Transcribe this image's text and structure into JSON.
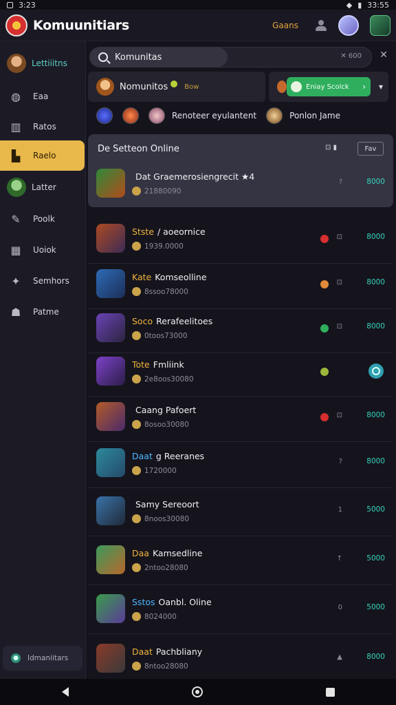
{
  "status": {
    "time": "3:23",
    "right": "33:55"
  },
  "appbar": {
    "title": "Komuunitiars",
    "games_link": "Gaans"
  },
  "sidebar": {
    "items": [
      {
        "label": "Lettiiitns",
        "icon": "avatar-icon"
      },
      {
        "label": "Eaa",
        "icon": "gamepad-icon"
      },
      {
        "label": "Ratos",
        "icon": "stats-icon"
      },
      {
        "label": "Raelo",
        "icon": "bookmark-icon",
        "active": true
      },
      {
        "label": "Latter",
        "icon": "avatar-icon"
      },
      {
        "label": "Poolk",
        "icon": "paint-icon"
      },
      {
        "label": "Uoiok",
        "icon": "calendar-icon"
      },
      {
        "label": "Semhors",
        "icon": "puzzle-icon"
      },
      {
        "label": "Patme",
        "icon": "people-icon"
      }
    ],
    "footer_label": "Idmaniitars"
  },
  "search": {
    "value": "Komunitas",
    "hint": "✕ 600"
  },
  "community": {
    "name": "Nomunitos",
    "extra": "Bow"
  },
  "join": {
    "button_label": "Eniay Scolck"
  },
  "chips": {
    "label1": "Renoteer eyulantent",
    "label2": "Ponlon Jame"
  },
  "section": {
    "title": "De Setteon Online",
    "icons": "⊡ ▮",
    "button_label": "Fav"
  },
  "rows": [
    {
      "tag": "",
      "tag_color": "#ffffff",
      "name": "Dat Graemerosiengrecit ★4",
      "sub": "21880090",
      "ind": "",
      "mini": "?",
      "val": "8000",
      "thumb_a": "#2f8a3a",
      "thumb_b": "#b24b1b"
    },
    {
      "tag": "Stste",
      "tag_color": "#f1b43d",
      "name": "/ aoeornice",
      "sub": "1939.0000",
      "ind": "#d62f2f",
      "mini": "⊡",
      "val": "8000",
      "thumb_a": "#ad4a22",
      "thumb_b": "#3c2b55"
    },
    {
      "tag": "Kate",
      "tag_color": "#f1b43d",
      "name": "Komseolline",
      "sub": "8ssoo78000",
      "ind": "#e08a3a",
      "mini": "⊡",
      "val": "8000",
      "thumb_a": "#2d6bb5",
      "thumb_b": "#1c2f58"
    },
    {
      "tag": "Soco",
      "tag_color": "#f1b43d",
      "name": "Rerafeelitoes",
      "sub": "0toos73000",
      "ind": "#2fae5e",
      "mini": "⊡",
      "val": "8000",
      "thumb_a": "#6a42b5",
      "thumb_b": "#2b2540"
    },
    {
      "tag": "Tote",
      "tag_color": "#f1b43d",
      "name": "Fmliink",
      "sub": "2e8oos30080",
      "ind": "#9bb83a",
      "mini": "",
      "val": "",
      "thumb_a": "#7d42c9",
      "thumb_b": "#2b1d48",
      "badge": true
    },
    {
      "tag": "",
      "tag_color": "#ffffff",
      "name": "Caang Pafoert",
      "sub": "8osoo30080",
      "ind": "#d62f2f",
      "mini": "⊡",
      "val": "8000",
      "thumb_a": "#b35b28",
      "thumb_b": "#4a2a6a"
    },
    {
      "tag": "Daat",
      "tag_color": "#4fb8ff",
      "name": "g Reeranes",
      "sub": "1720000",
      "ind": "",
      "mini": "?",
      "val": "8000",
      "thumb_a": "#2d8a9b",
      "thumb_b": "#244a6b"
    },
    {
      "tag": "",
      "tag_color": "#ffffff",
      "name": "Samy Sereoort",
      "sub": "8noos30080",
      "ind": "",
      "mini": "1",
      "val": "5000",
      "thumb_a": "#3a72a8",
      "thumb_b": "#1f2a38"
    },
    {
      "tag": "Daa",
      "tag_color": "#f1b43d",
      "name": "Kamsedline",
      "sub": "2ntoo28080",
      "ind": "",
      "mini": "↑",
      "val": "5000",
      "thumb_a": "#3d9a5c",
      "thumb_b": "#b7672b"
    },
    {
      "tag": "Sstos",
      "tag_color": "#4fb8ff",
      "name": "Oanbl. Oline",
      "sub": "8024000",
      "ind": "",
      "mini": "0",
      "val": "5000",
      "thumb_a": "#3a9c4a",
      "thumb_b": "#5a3a9a"
    },
    {
      "tag": "Daat",
      "tag_color": "#f1b43d",
      "name": "Pachbliany",
      "sub": "8ntoo28080",
      "ind": "",
      "mini": "▲",
      "val": "8000",
      "thumb_a": "#8a3a2a",
      "thumb_b": "#3a3a3a"
    }
  ]
}
